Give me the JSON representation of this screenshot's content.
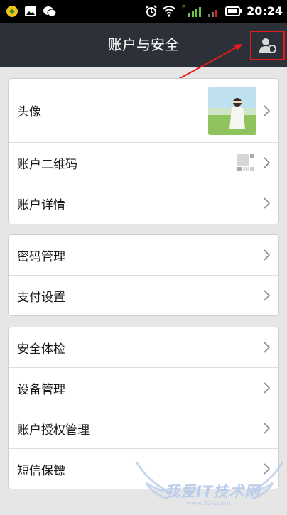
{
  "status_bar": {
    "time": "20:24",
    "signal_label": "E",
    "icons": [
      "notification-app-icon",
      "image-icon",
      "wechat-icon",
      "alarm-icon",
      "wifi-icon",
      "signal-icon",
      "battery-icon"
    ]
  },
  "header": {
    "title": "账户与安全",
    "right_icon": "account-switch-icon"
  },
  "groups": [
    {
      "rows": [
        {
          "label": "头像",
          "accessory": "avatar-image"
        },
        {
          "label": "账户二维码",
          "accessory": "qr-code-icon"
        },
        {
          "label": "账户详情"
        }
      ]
    },
    {
      "rows": [
        {
          "label": "密码管理"
        },
        {
          "label": "支付设置"
        }
      ]
    },
    {
      "rows": [
        {
          "label": "安全体检"
        },
        {
          "label": "设备管理"
        },
        {
          "label": "账户授权管理"
        },
        {
          "label": "短信保镖"
        }
      ]
    }
  ],
  "watermark": {
    "text": "我爱IT技术网",
    "url": "www.52ij.com"
  },
  "colors": {
    "header_bg": "#2c3039",
    "annotation_red": "#e31c1c",
    "page_bg": "#e6e6e6"
  }
}
